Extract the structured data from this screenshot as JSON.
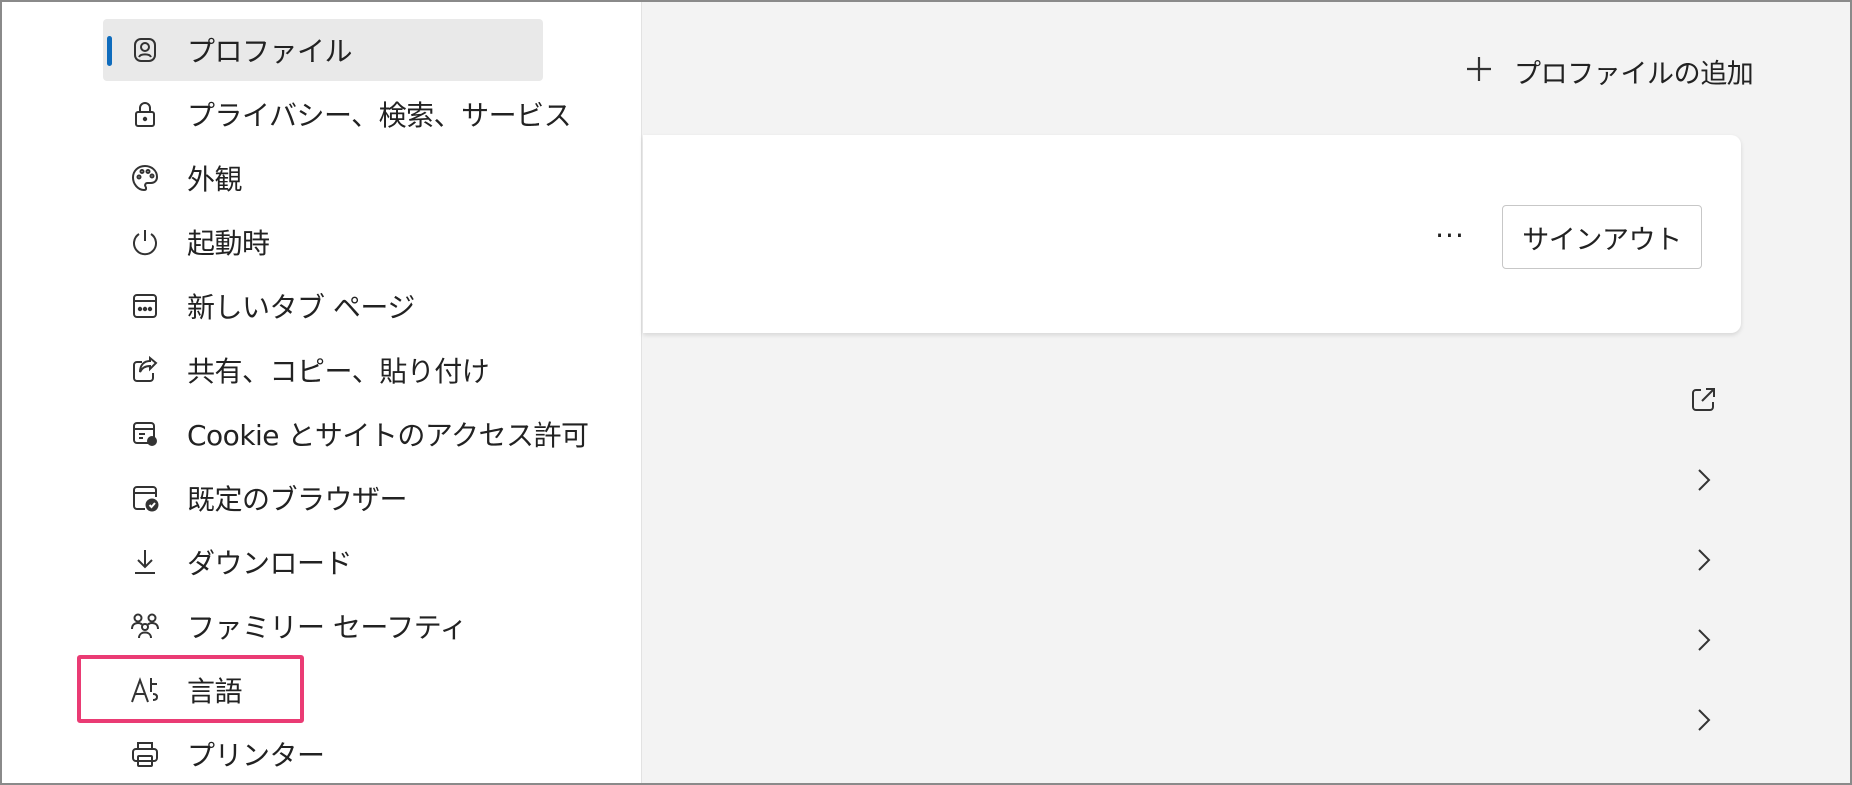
{
  "sidebar": {
    "items": [
      {
        "label": "プロファイル",
        "icon": "profile-icon",
        "active": true
      },
      {
        "label": "プライバシー、検索、サービス",
        "icon": "lock-icon"
      },
      {
        "label": "外観",
        "icon": "palette-icon"
      },
      {
        "label": "起動時",
        "icon": "power-icon"
      },
      {
        "label": "新しいタブ ページ",
        "icon": "new-tab-page-icon"
      },
      {
        "label": "共有、コピー、貼り付け",
        "icon": "share-icon"
      },
      {
        "label": "Cookie とサイトのアクセス許可",
        "icon": "cookie-site-permissions-icon"
      },
      {
        "label": "既定のブラウザー",
        "icon": "default-browser-icon"
      },
      {
        "label": "ダウンロード",
        "icon": "download-icon"
      },
      {
        "label": "ファミリー セーフティ",
        "icon": "family-safety-icon"
      },
      {
        "label": "言語",
        "icon": "language-icon"
      },
      {
        "label": "プリンター",
        "icon": "printer-icon"
      }
    ]
  },
  "main": {
    "add_profile_label": "プロファイルの追加",
    "profile_card": {
      "more_label": "···",
      "signout_label": "サインアウト"
    }
  },
  "colors": {
    "accent": "#0f6cbd",
    "highlight": "#ea3b74"
  }
}
